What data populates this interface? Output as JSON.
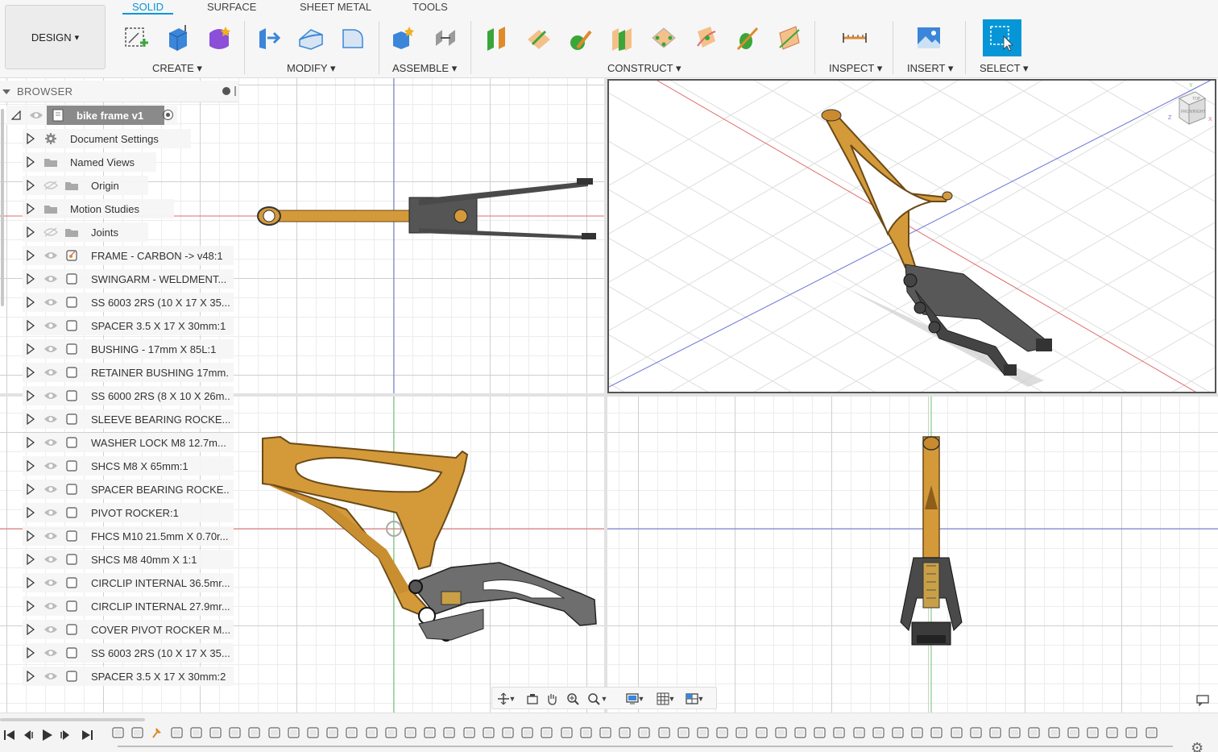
{
  "toolbar": {
    "workspace_label": "DESIGN",
    "tabs": [
      {
        "label": "SOLID",
        "active": true
      },
      {
        "label": "SURFACE",
        "active": false
      },
      {
        "label": "SHEET METAL",
        "active": false
      },
      {
        "label": "TOOLS",
        "active": false
      }
    ],
    "groups": {
      "create": "CREATE",
      "modify": "MODIFY",
      "assemble": "ASSEMBLE",
      "construct": "CONSTRUCT",
      "inspect": "INSPECT",
      "insert": "INSERT",
      "select": "SELECT"
    },
    "dropdown_glyph": "▾"
  },
  "browser": {
    "title": "BROWSER",
    "root": "bike frame v1",
    "items": [
      {
        "label": "Document Settings",
        "icon": "gear-icon",
        "vis": "none"
      },
      {
        "label": "Named Views",
        "icon": "folder-icon",
        "vis": "none"
      },
      {
        "label": "Origin",
        "icon": "folder-icon",
        "vis": "hidden"
      },
      {
        "label": "Motion Studies",
        "icon": "folder-icon",
        "vis": "none"
      },
      {
        "label": "Joints",
        "icon": "folder-icon",
        "vis": "hidden"
      },
      {
        "label": "FRAME - CARBON -> v48:1",
        "icon": "linked-component-icon",
        "vis": "visible"
      },
      {
        "label": "SWINGARM - WELDMENT...",
        "icon": "component-icon",
        "vis": "visible"
      },
      {
        "label": "SS 6003 2RS (10 X 17 X 35...",
        "icon": "component-icon",
        "vis": "visible"
      },
      {
        "label": "SPACER 3.5 X 17 X 30mm:1",
        "icon": "component-icon",
        "vis": "visible"
      },
      {
        "label": "BUSHING - 17mm X 85L:1",
        "icon": "component-icon",
        "vis": "visible"
      },
      {
        "label": "RETAINER BUSHING 17mm...",
        "icon": "component-icon",
        "vis": "visible"
      },
      {
        "label": "SS 6000 2RS (8 X 10 X 26m...",
        "icon": "component-icon",
        "vis": "visible"
      },
      {
        "label": "SLEEVE BEARING ROCKE...",
        "icon": "component-icon",
        "vis": "visible"
      },
      {
        "label": "WASHER LOCK M8 12.7m...",
        "icon": "component-icon",
        "vis": "visible"
      },
      {
        "label": "SHCS M8 X 65mm:1",
        "icon": "component-icon",
        "vis": "visible"
      },
      {
        "label": "SPACER BEARING ROCKE...",
        "icon": "component-icon",
        "vis": "visible"
      },
      {
        "label": "PIVOT ROCKER:1",
        "icon": "component-icon",
        "vis": "visible"
      },
      {
        "label": "FHCS M10 21.5mm X 0.70r...",
        "icon": "component-icon",
        "vis": "visible"
      },
      {
        "label": "SHCS M8 40mm X 1:1",
        "icon": "component-icon",
        "vis": "visible"
      },
      {
        "label": "CIRCLIP INTERNAL 36.5mr...",
        "icon": "component-icon",
        "vis": "visible"
      },
      {
        "label": "CIRCLIP INTERNAL 27.9mr...",
        "icon": "component-icon",
        "vis": "visible"
      },
      {
        "label": "COVER PIVOT ROCKER M...",
        "icon": "component-icon",
        "vis": "visible"
      },
      {
        "label": "SS 6003 2RS (10 X 17 X 35...",
        "icon": "component-icon",
        "vis": "visible"
      },
      {
        "label": "SPACER 3.5 X 17 X 30mm:2",
        "icon": "component-icon",
        "vis": "visible"
      }
    ]
  },
  "viewcube": {
    "top": "TOP",
    "front": "FRONT",
    "right": "RIGHT",
    "axis_x": "X",
    "axis_y": "Y",
    "axis_z": "Z"
  },
  "colors": {
    "accent": "#0696d7",
    "frame": "#d49a3a",
    "frame_dark": "#8c5e1a",
    "swingarm": "#6e6e6e",
    "axis_red": "#e06c6c",
    "axis_blue": "#6a74d6",
    "axis_green": "#6cc46c"
  }
}
